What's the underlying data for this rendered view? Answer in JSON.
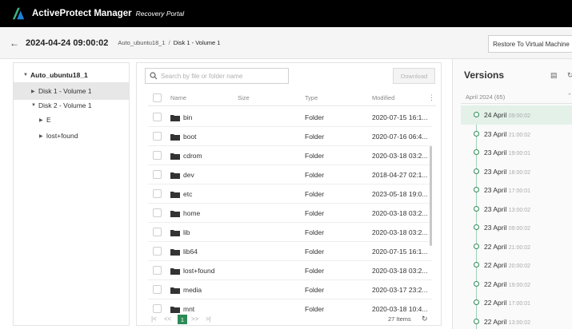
{
  "app": {
    "name": "ActiveProtect Manager",
    "subtitle": "Recovery Portal",
    "brand_color": "#2e8b57"
  },
  "header": {
    "back_icon": "back-arrow-icon",
    "title": "2024-04-24 09:00:02",
    "breadcrumb": [
      "Auto_ubuntu18_1",
      "Disk 1 - Volume 1"
    ],
    "breadcrumb_separator": "/",
    "restore_label": "Restore To Virtual Machine"
  },
  "tree": {
    "items": [
      {
        "label": "Auto_ubuntu18_1",
        "caret": "▼"
      },
      {
        "label": "Disk 1 - Volume 1",
        "caret": "▶",
        "selected": true
      },
      {
        "label": "Disk 2 - Volume 1",
        "caret": "▼"
      },
      {
        "label": "E",
        "caret": "▶"
      },
      {
        "label": "lost+found",
        "caret": "▶"
      }
    ]
  },
  "files": {
    "search_placeholder": "Search by file or folder name",
    "download_label": "Download",
    "columns": {
      "name": "Name",
      "size": "Size",
      "type": "Type",
      "modified": "Modified"
    },
    "column_menu": "⋮",
    "rows": [
      {
        "name": "bin",
        "size": "",
        "type": "Folder",
        "modified": "2020-07-15 16:1..."
      },
      {
        "name": "boot",
        "size": "",
        "type": "Folder",
        "modified": "2020-07-16 06:4..."
      },
      {
        "name": "cdrom",
        "size": "",
        "type": "Folder",
        "modified": "2020-03-18 03:2..."
      },
      {
        "name": "dev",
        "size": "",
        "type": "Folder",
        "modified": "2018-04-27 02:1..."
      },
      {
        "name": "etc",
        "size": "",
        "type": "Folder",
        "modified": "2023-05-18 19:0..."
      },
      {
        "name": "home",
        "size": "",
        "type": "Folder",
        "modified": "2020-03-18 03:2..."
      },
      {
        "name": "lib",
        "size": "",
        "type": "Folder",
        "modified": "2020-03-18 03:2..."
      },
      {
        "name": "lib64",
        "size": "",
        "type": "Folder",
        "modified": "2020-07-15 16:1..."
      },
      {
        "name": "lost+found",
        "size": "",
        "type": "Folder",
        "modified": "2020-03-18 03:2..."
      },
      {
        "name": "media",
        "size": "",
        "type": "Folder",
        "modified": "2020-03-17 23:2..."
      },
      {
        "name": "mnt",
        "size": "",
        "type": "Folder",
        "modified": "2020-03-18 10:4..."
      }
    ],
    "pagination": {
      "first": "|<",
      "prev": "<<",
      "current": "1",
      "next": ">>",
      "last": ">|",
      "items_text": "27 Items",
      "refresh_icon": "↻"
    }
  },
  "versions": {
    "title": "Versions",
    "icons": [
      "calendar-icon",
      "refresh-icon"
    ],
    "month_label": "April 2024 (65)",
    "month_caret": "⌃",
    "items": [
      {
        "date": "24 April",
        "time": "09:00:02",
        "selected": true
      },
      {
        "date": "23 April",
        "time": "21:00:02"
      },
      {
        "date": "23 April",
        "time": "19:00:01"
      },
      {
        "date": "23 April",
        "time": "18:00:02"
      },
      {
        "date": "23 April",
        "time": "17:00:01"
      },
      {
        "date": "23 April",
        "time": "13:00:02"
      },
      {
        "date": "23 April",
        "time": "09:00:02"
      },
      {
        "date": "22 April",
        "time": "21:00:02"
      },
      {
        "date": "22 April",
        "time": "20:00:02"
      },
      {
        "date": "22 April",
        "time": "19:00:02"
      },
      {
        "date": "22 April",
        "time": "17:00:01"
      },
      {
        "date": "22 April",
        "time": "13:00:02"
      }
    ]
  }
}
